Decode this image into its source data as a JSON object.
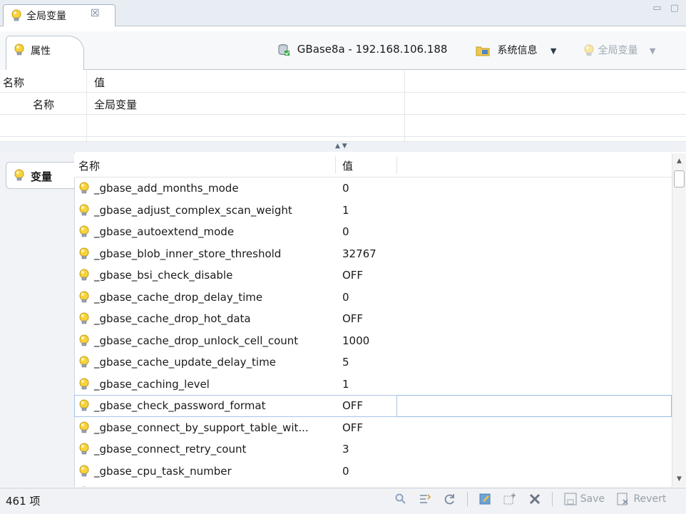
{
  "tab": {
    "title": "全局变量",
    "close": "☒"
  },
  "window_controls": "▭ ▢",
  "properties_tab": {
    "label": "属性"
  },
  "toolbar": {
    "connection": "GBase8a - 192.168.106.188",
    "sysinfo": "系统信息",
    "global_vars": "全局变量",
    "caret": "▼"
  },
  "props_table": {
    "col_name": "名称",
    "col_value": "值",
    "rows": [
      {
        "name": "名称",
        "value": "全局变量"
      }
    ]
  },
  "variables_tab": {
    "label": "变量"
  },
  "var_grid": {
    "col_name": "名称",
    "col_value": "值",
    "rows": [
      {
        "name": "_gbase_add_months_mode",
        "value": "0"
      },
      {
        "name": "_gbase_adjust_complex_scan_weight",
        "value": "1"
      },
      {
        "name": "_gbase_autoextend_mode",
        "value": "0"
      },
      {
        "name": "_gbase_blob_inner_store_threshold",
        "value": "32767"
      },
      {
        "name": "_gbase_bsi_check_disable",
        "value": "OFF"
      },
      {
        "name": "_gbase_cache_drop_delay_time",
        "value": "0"
      },
      {
        "name": "_gbase_cache_drop_hot_data",
        "value": "OFF"
      },
      {
        "name": "_gbase_cache_drop_unlock_cell_count",
        "value": "1000"
      },
      {
        "name": "_gbase_cache_update_delay_time",
        "value": "5"
      },
      {
        "name": "_gbase_caching_level",
        "value": "1"
      },
      {
        "name": "_gbase_check_password_format",
        "value": "OFF"
      },
      {
        "name": "_gbase_connect_by_support_table_wit...",
        "value": "OFF"
      },
      {
        "name": "_gbase_connect_retry_count",
        "value": "3"
      },
      {
        "name": "_gbase_cpu_task_number",
        "value": "0"
      }
    ],
    "selected_index": 10
  },
  "status": {
    "count": "461 项",
    "save": "Save",
    "revert": "Revert"
  },
  "colors": {
    "accent": "#f5c518",
    "selection": "#a8c4e4"
  }
}
